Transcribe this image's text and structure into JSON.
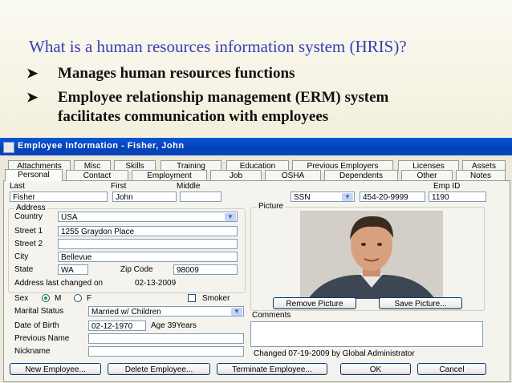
{
  "slide": {
    "title": "What is a human resources information system (HRIS)?",
    "bullets": [
      {
        "line1": "Manages human resources functions",
        "line2": ""
      },
      {
        "line1": "Employee relationship management (ERM) system",
        "line2": "facilitates communication with employees"
      }
    ]
  },
  "window": {
    "title": "Employee Information - Fisher, John"
  },
  "tabs_back": [
    "Attachments",
    "Misc",
    "Skills",
    "Training",
    "Education",
    "Previous Employers",
    "Licenses",
    "Assets"
  ],
  "tabs_front": [
    "Personal",
    "Contact",
    "Employment",
    "Job",
    "OSHA",
    "Dependents",
    "Other",
    "Notes"
  ],
  "name": {
    "last_label": "Last",
    "last_value": "Fisher",
    "first_label": "First",
    "first_value": "John",
    "middle_label": "Middle",
    "middle_value": "",
    "id_type": "SSN",
    "ssn_value": "454-20-9999",
    "emp_id_label": "Emp ID",
    "emp_id_value": "1190"
  },
  "address": {
    "group_label": "Address",
    "country_label": "Country",
    "country_value": "USA",
    "street1_label": "Street 1",
    "street1_value": "1255 Graydon Place",
    "street2_label": "Street 2",
    "street2_value": "",
    "city_label": "City",
    "city_value": "Bellevue",
    "state_label": "State",
    "state_value": "WA",
    "zip_label": "Zip Code",
    "zip_value": "98009",
    "last_changed_label": "Address last changed on",
    "last_changed_value": "02-13-2009"
  },
  "personal": {
    "sex_label": "Sex",
    "sex_m": "M",
    "sex_f": "F",
    "smoker_label": "Smoker",
    "marital_label": "Marital Status",
    "marital_value": "Married w/ Children",
    "dob_label": "Date of Birth",
    "dob_value": "02-12-1970",
    "age_value": "Age 39Years",
    "prev_name_label": "Previous Name",
    "prev_name_value": "",
    "nickname_label": "Nickname",
    "nickname_value": ""
  },
  "picture": {
    "group_label": "Picture",
    "remove_label": "Remove Picture",
    "save_label": "Save Picture..."
  },
  "comments": {
    "label": "Comments",
    "value": "",
    "changed_text": "Changed 07-19-2009 by Global Administrator"
  },
  "buttons": {
    "new": "New Employee...",
    "delete": "Delete Employee...",
    "terminate": "Terminate Employee...",
    "ok": "OK",
    "cancel": "Cancel"
  },
  "colors": {
    "title_blue": "#3b3bb8",
    "window_title": "#0a56d8",
    "face": "#ece9d8"
  }
}
